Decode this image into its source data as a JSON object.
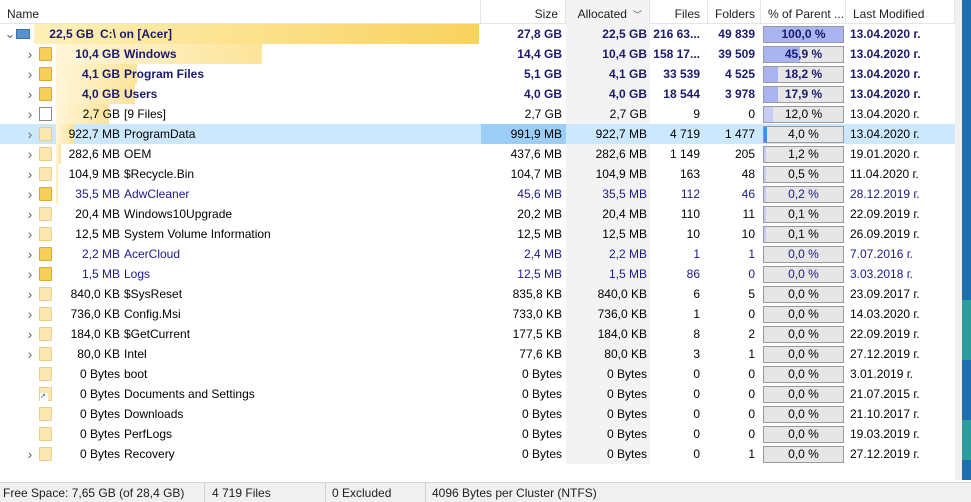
{
  "columns": {
    "name": "Name",
    "size": "Size",
    "allocated": "Allocated",
    "files": "Files",
    "folders": "Folders",
    "pct_parent": "% of Parent ...",
    "last_modified": "Last Modified"
  },
  "rows": [
    {
      "tree_size": "22,5 GB",
      "name": "C:\\  on  [Acer]",
      "size": "27,8 GB",
      "allocated": "22,5 GB",
      "files": "216 63...",
      "folders": "49 839",
      "pct": "100,0 %",
      "pct_value": 100.0,
      "modified": "13.04.2020 г.",
      "icon": "drive-icon",
      "expander": "chevron-down-icon"
    },
    {
      "tree_size": "10,4 GB",
      "name": "Windows",
      "size": "14,4 GB",
      "allocated": "10,4 GB",
      "files": "158 17...",
      "folders": "39 509",
      "pct": "45,9 %",
      "pct_value": 45.9,
      "modified": "13.04.2020 г.",
      "icon": "folder-icon",
      "expander": "chevron-right-icon"
    },
    {
      "tree_size": "4,1 GB",
      "name": "Program Files",
      "size": "5,1 GB",
      "allocated": "4,1 GB",
      "files": "33 539",
      "folders": "4 525",
      "pct": "18,2 %",
      "pct_value": 18.2,
      "modified": "13.04.2020 г.",
      "icon": "folder-icon",
      "expander": "chevron-right-icon"
    },
    {
      "tree_size": "4,0 GB",
      "name": "Users",
      "size": "4,0 GB",
      "allocated": "4,0 GB",
      "files": "18 544",
      "folders": "3 978",
      "pct": "17,9 %",
      "pct_value": 17.9,
      "modified": "13.04.2020 г.",
      "icon": "folder-icon",
      "expander": "chevron-right-icon"
    },
    {
      "tree_size": "2,7 GB",
      "name": "[9 Files]",
      "size": "2,7 GB",
      "allocated": "2,7 GB",
      "files": "9",
      "folders": "0",
      "pct": "12,0 %",
      "pct_value": 12.0,
      "modified": "13.04.2020 г.",
      "icon": "file-icon",
      "expander": "chevron-right-icon"
    },
    {
      "tree_size": "922,7 MB",
      "name": "ProgramData",
      "size": "991,9 MB",
      "allocated": "922,7 MB",
      "files": "4 719",
      "folders": "1 477",
      "pct": "4,0 %",
      "pct_value": 4.0,
      "modified": "13.04.2020 г.",
      "icon": "folder-icon",
      "expander": "chevron-right-icon"
    },
    {
      "tree_size": "282,6 MB",
      "name": "OEM",
      "size": "437,6 MB",
      "allocated": "282,6 MB",
      "files": "1 149",
      "folders": "205",
      "pct": "1,2 %",
      "pct_value": 1.2,
      "modified": "19.01.2020 г.",
      "icon": "folder-icon",
      "expander": "chevron-right-icon"
    },
    {
      "tree_size": "104,9 MB",
      "name": "$Recycle.Bin",
      "size": "104,7 MB",
      "allocated": "104,9 MB",
      "files": "163",
      "folders": "48",
      "pct": "0,5 %",
      "pct_value": 0.5,
      "modified": "11.04.2020 г.",
      "icon": "folder-icon",
      "expander": "chevron-right-icon"
    },
    {
      "tree_size": "35,5 MB",
      "name": "AdwCleaner",
      "size": "45,6 MB",
      "allocated": "35,5 MB",
      "files": "112",
      "folders": "46",
      "pct": "0,2 %",
      "pct_value": 0.2,
      "modified": "28.12.2019 г.",
      "icon": "folder-icon",
      "expander": "chevron-right-icon"
    },
    {
      "tree_size": "20,4 MB",
      "name": "Windows10Upgrade",
      "size": "20,2 MB",
      "allocated": "20,4 MB",
      "files": "110",
      "folders": "11",
      "pct": "0,1 %",
      "pct_value": 0.1,
      "modified": "22.09.2019 г.",
      "icon": "folder-icon",
      "expander": "chevron-right-icon"
    },
    {
      "tree_size": "12,5 MB",
      "name": "System Volume Information",
      "size": "12,5 MB",
      "allocated": "12,5 MB",
      "files": "10",
      "folders": "10",
      "pct": "0,1 %",
      "pct_value": 0.1,
      "modified": "26.09.2019 г.",
      "icon": "folder-icon",
      "expander": "chevron-right-icon"
    },
    {
      "tree_size": "2,2 MB",
      "name": "AcerCloud",
      "size": "2,4 MB",
      "allocated": "2,2 MB",
      "files": "1",
      "folders": "1",
      "pct": "0,0 %",
      "pct_value": 0.0,
      "modified": "7.07.2016 г.",
      "icon": "folder-icon",
      "expander": "chevron-right-icon"
    },
    {
      "tree_size": "1,5 MB",
      "name": "Logs",
      "size": "12,5 MB",
      "allocated": "1,5 MB",
      "files": "86",
      "folders": "0",
      "pct": "0,0 %",
      "pct_value": 0.0,
      "modified": "3.03.2018 г.",
      "icon": "folder-icon",
      "expander": "chevron-right-icon"
    },
    {
      "tree_size": "840,0 KB",
      "name": "$SysReset",
      "size": "835,8 KB",
      "allocated": "840,0 KB",
      "files": "6",
      "folders": "5",
      "pct": "0,0 %",
      "pct_value": 0.0,
      "modified": "23.09.2017 г.",
      "icon": "folder-icon",
      "expander": "chevron-right-icon"
    },
    {
      "tree_size": "736,0 KB",
      "name": "Config.Msi",
      "size": "733,0 KB",
      "allocated": "736,0 KB",
      "files": "1",
      "folders": "0",
      "pct": "0,0 %",
      "pct_value": 0.0,
      "modified": "14.03.2020 г.",
      "icon": "folder-icon",
      "expander": "chevron-right-icon"
    },
    {
      "tree_size": "184,0 KB",
      "name": "$GetCurrent",
      "size": "177,5 KB",
      "allocated": "184,0 KB",
      "files": "8",
      "folders": "2",
      "pct": "0,0 %",
      "pct_value": 0.0,
      "modified": "22.09.2019 г.",
      "icon": "folder-icon",
      "expander": "chevron-right-icon"
    },
    {
      "tree_size": "80,0 KB",
      "name": "Intel",
      "size": "77,6 KB",
      "allocated": "80,0 KB",
      "files": "3",
      "folders": "1",
      "pct": "0,0 %",
      "pct_value": 0.0,
      "modified": "27.12.2019 г.",
      "icon": "folder-icon",
      "expander": "chevron-right-icon"
    },
    {
      "tree_size": "0 Bytes",
      "name": "boot",
      "size": "0 Bytes",
      "allocated": "0 Bytes",
      "files": "0",
      "folders": "0",
      "pct": "0,0 %",
      "pct_value": 0.0,
      "modified": "3.01.2019 г.",
      "icon": "folder-icon",
      "expander": ""
    },
    {
      "tree_size": "0 Bytes",
      "name": "Documents and Settings",
      "size": "0 Bytes",
      "allocated": "0 Bytes",
      "files": "0",
      "folders": "0",
      "pct": "0,0 %",
      "pct_value": 0.0,
      "modified": "21.07.2015 г.",
      "icon": "shortcut-icon",
      "expander": ""
    },
    {
      "tree_size": "0 Bytes",
      "name": "Downloads",
      "size": "0 Bytes",
      "allocated": "0 Bytes",
      "files": "0",
      "folders": "0",
      "pct": "0,0 %",
      "pct_value": 0.0,
      "modified": "21.10.2017 г.",
      "icon": "folder-icon",
      "expander": ""
    },
    {
      "tree_size": "0 Bytes",
      "name": "PerfLogs",
      "size": "0 Bytes",
      "allocated": "0 Bytes",
      "files": "0",
      "folders": "0",
      "pct": "0,0 %",
      "pct_value": 0.0,
      "modified": "19.03.2019 г.",
      "icon": "folder-icon",
      "expander": ""
    },
    {
      "tree_size": "0 Bytes",
      "name": "Recovery",
      "size": "0 Bytes",
      "allocated": "0 Bytes",
      "files": "0",
      "folders": "1",
      "pct": "0,0 %",
      "pct_value": 0.0,
      "modified": "27.12.2019 г.",
      "icon": "folder-icon",
      "expander": "chevron-right-icon"
    }
  ],
  "selected_row": 5,
  "statusbar": {
    "free_space": "Free Space: 7,65 GB  (of 28,4 GB)",
    "files": "4 719  Files",
    "excluded": "0 Excluded",
    "cluster": "4096  Bytes per Cluster (NTFS)"
  },
  "colors": {
    "selection": "#cce8ff",
    "size_bar": "#f8d25e",
    "pct_bar": "#a9b4f0",
    "pct_bar_selected": "#3d8ef0",
    "bold_text": "#1a1a6e"
  }
}
